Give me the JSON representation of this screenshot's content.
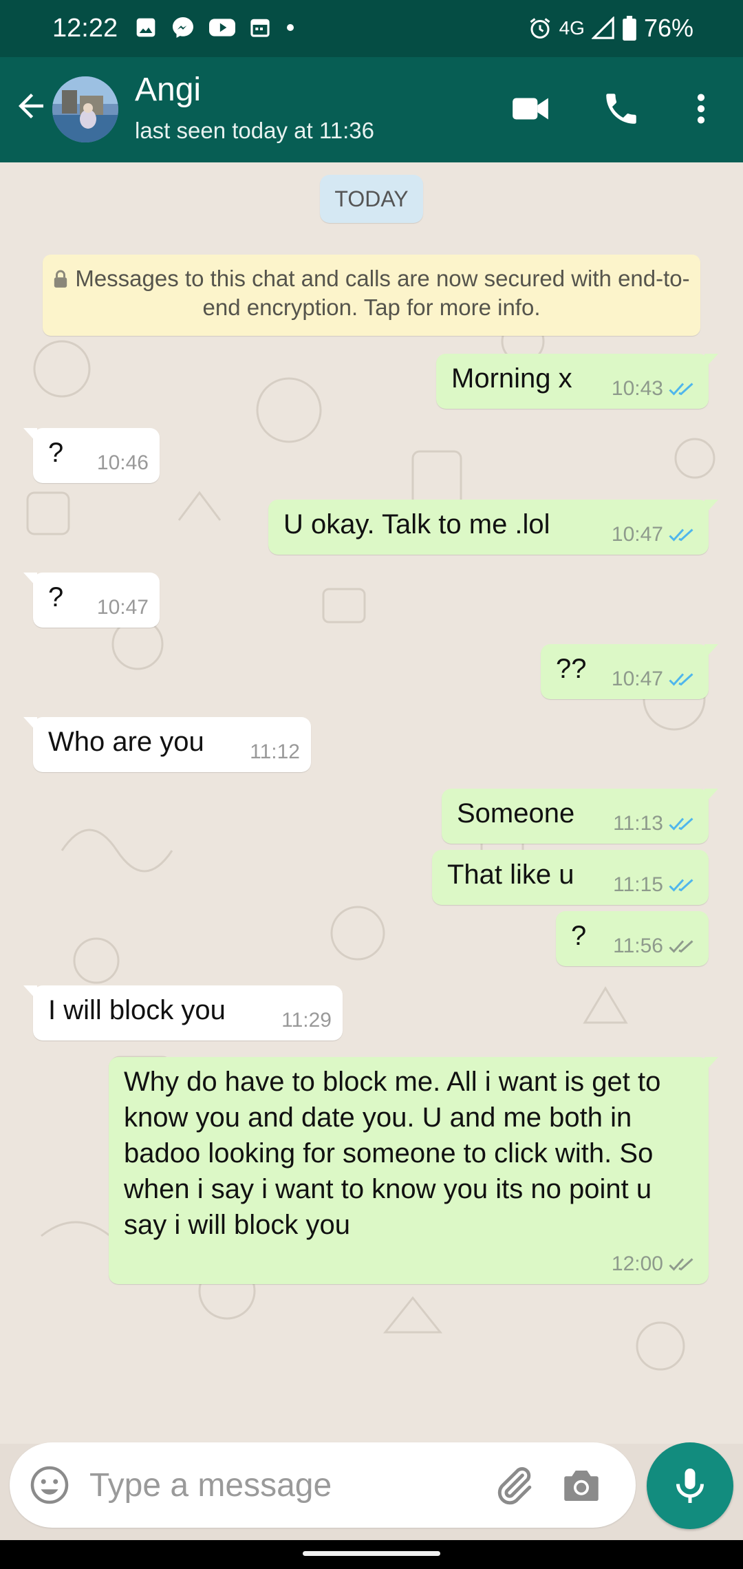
{
  "status_bar": {
    "time": "12:22",
    "network": "4G",
    "battery": "76%"
  },
  "header": {
    "contact_name": "Angi",
    "last_seen": "last seen today at 11:36"
  },
  "chat": {
    "date_label": "TODAY",
    "encryption_notice": "Messages to this chat and calls are now secured with end-to-end encryption. Tap for more info.",
    "messages": [
      {
        "direction": "outgoing",
        "text": "Morning x",
        "time": "10:43",
        "status": "read"
      },
      {
        "direction": "incoming",
        "text": "?",
        "time": "10:46"
      },
      {
        "direction": "outgoing",
        "text": "U okay.  Talk to me .lol",
        "time": "10:47",
        "status": "read"
      },
      {
        "direction": "incoming",
        "text": "?",
        "time": "10:47"
      },
      {
        "direction": "outgoing",
        "text": "??",
        "time": "10:47",
        "status": "read"
      },
      {
        "direction": "incoming",
        "text": "Who are you",
        "time": "11:12"
      },
      {
        "direction": "outgoing",
        "text": "Someone",
        "time": "11:13",
        "status": "read"
      },
      {
        "direction": "outgoing",
        "text": "That like u",
        "time": "11:15",
        "status": "read"
      },
      {
        "direction": "outgoing",
        "text": "?",
        "time": "11:56",
        "status": "delivered"
      },
      {
        "direction": "incoming",
        "text": "I will block you",
        "time": "11:29"
      },
      {
        "direction": "outgoing",
        "text": "Why do have to block me.  All i want is get to know you and date you.  U  and me both in badoo looking for someone  to click with. So when i say i want to know you  its no point u say i  will block you",
        "time": "12:00",
        "status": "delivered"
      }
    ]
  },
  "composer": {
    "placeholder": "Type a message"
  },
  "colors": {
    "header": "#075e54",
    "status_bar": "#054d44",
    "outgoing_bubble": "#dcf8c6",
    "incoming_bubble": "#ffffff",
    "read_ticks": "#4fb6ec",
    "delivered_ticks": "#8e9a8c",
    "mic_button": "#128c7e"
  },
  "icons": {
    "status": [
      "gallery-icon",
      "messenger-icon",
      "youtube-icon",
      "calendar-icon",
      "dot-icon",
      "alarm-icon",
      "signal-icon",
      "battery-icon"
    ],
    "header": [
      "back-arrow-icon",
      "video-call-icon",
      "voice-call-icon",
      "more-options-icon"
    ],
    "composer": [
      "emoji-icon",
      "attach-icon",
      "camera-icon",
      "mic-icon"
    ]
  }
}
